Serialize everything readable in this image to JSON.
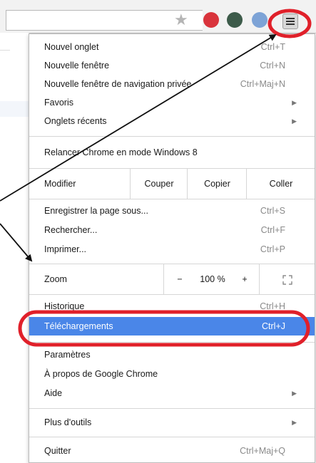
{
  "toolbar": {
    "star_icon": "star-icon",
    "menu_icon": "hamburger-menu-icon",
    "extension_colors": [
      "#d9343c",
      "#3d5b4a",
      "#7da3d6"
    ]
  },
  "menu": {
    "new_tab": {
      "label": "Nouvel onglet",
      "shortcut": "Ctrl+T"
    },
    "new_window": {
      "label": "Nouvelle fenêtre",
      "shortcut": "Ctrl+N"
    },
    "incognito": {
      "label": "Nouvelle fenêtre de navigation privée",
      "shortcut": "Ctrl+Maj+N"
    },
    "favorites": {
      "label": "Favoris"
    },
    "recent_tabs": {
      "label": "Onglets récents"
    },
    "relaunch": {
      "label": "Relancer Chrome en mode Windows 8"
    },
    "edit": {
      "label": "Modifier",
      "cut": "Couper",
      "copy": "Copier",
      "paste": "Coller"
    },
    "save_page": {
      "label": "Enregistrer la page sous...",
      "shortcut": "Ctrl+S"
    },
    "find": {
      "label": "Rechercher...",
      "shortcut": "Ctrl+F"
    },
    "print": {
      "label": "Imprimer...",
      "shortcut": "Ctrl+P"
    },
    "zoom": {
      "label": "Zoom",
      "minus": "−",
      "value": "100 %",
      "plus": "+"
    },
    "history": {
      "label": "Historique",
      "shortcut": "Ctrl+H"
    },
    "downloads": {
      "label": "Téléchargements",
      "shortcut": "Ctrl+J"
    },
    "settings": {
      "label": "Paramètres"
    },
    "about": {
      "label": "À propos de Google Chrome"
    },
    "help": {
      "label": "Aide"
    },
    "more_tools": {
      "label": "Plus d'outils"
    },
    "quit": {
      "label": "Quitter",
      "shortcut": "Ctrl+Maj+Q"
    }
  },
  "colors": {
    "highlight": "#4a86e8",
    "annotation": "#e0202a"
  }
}
